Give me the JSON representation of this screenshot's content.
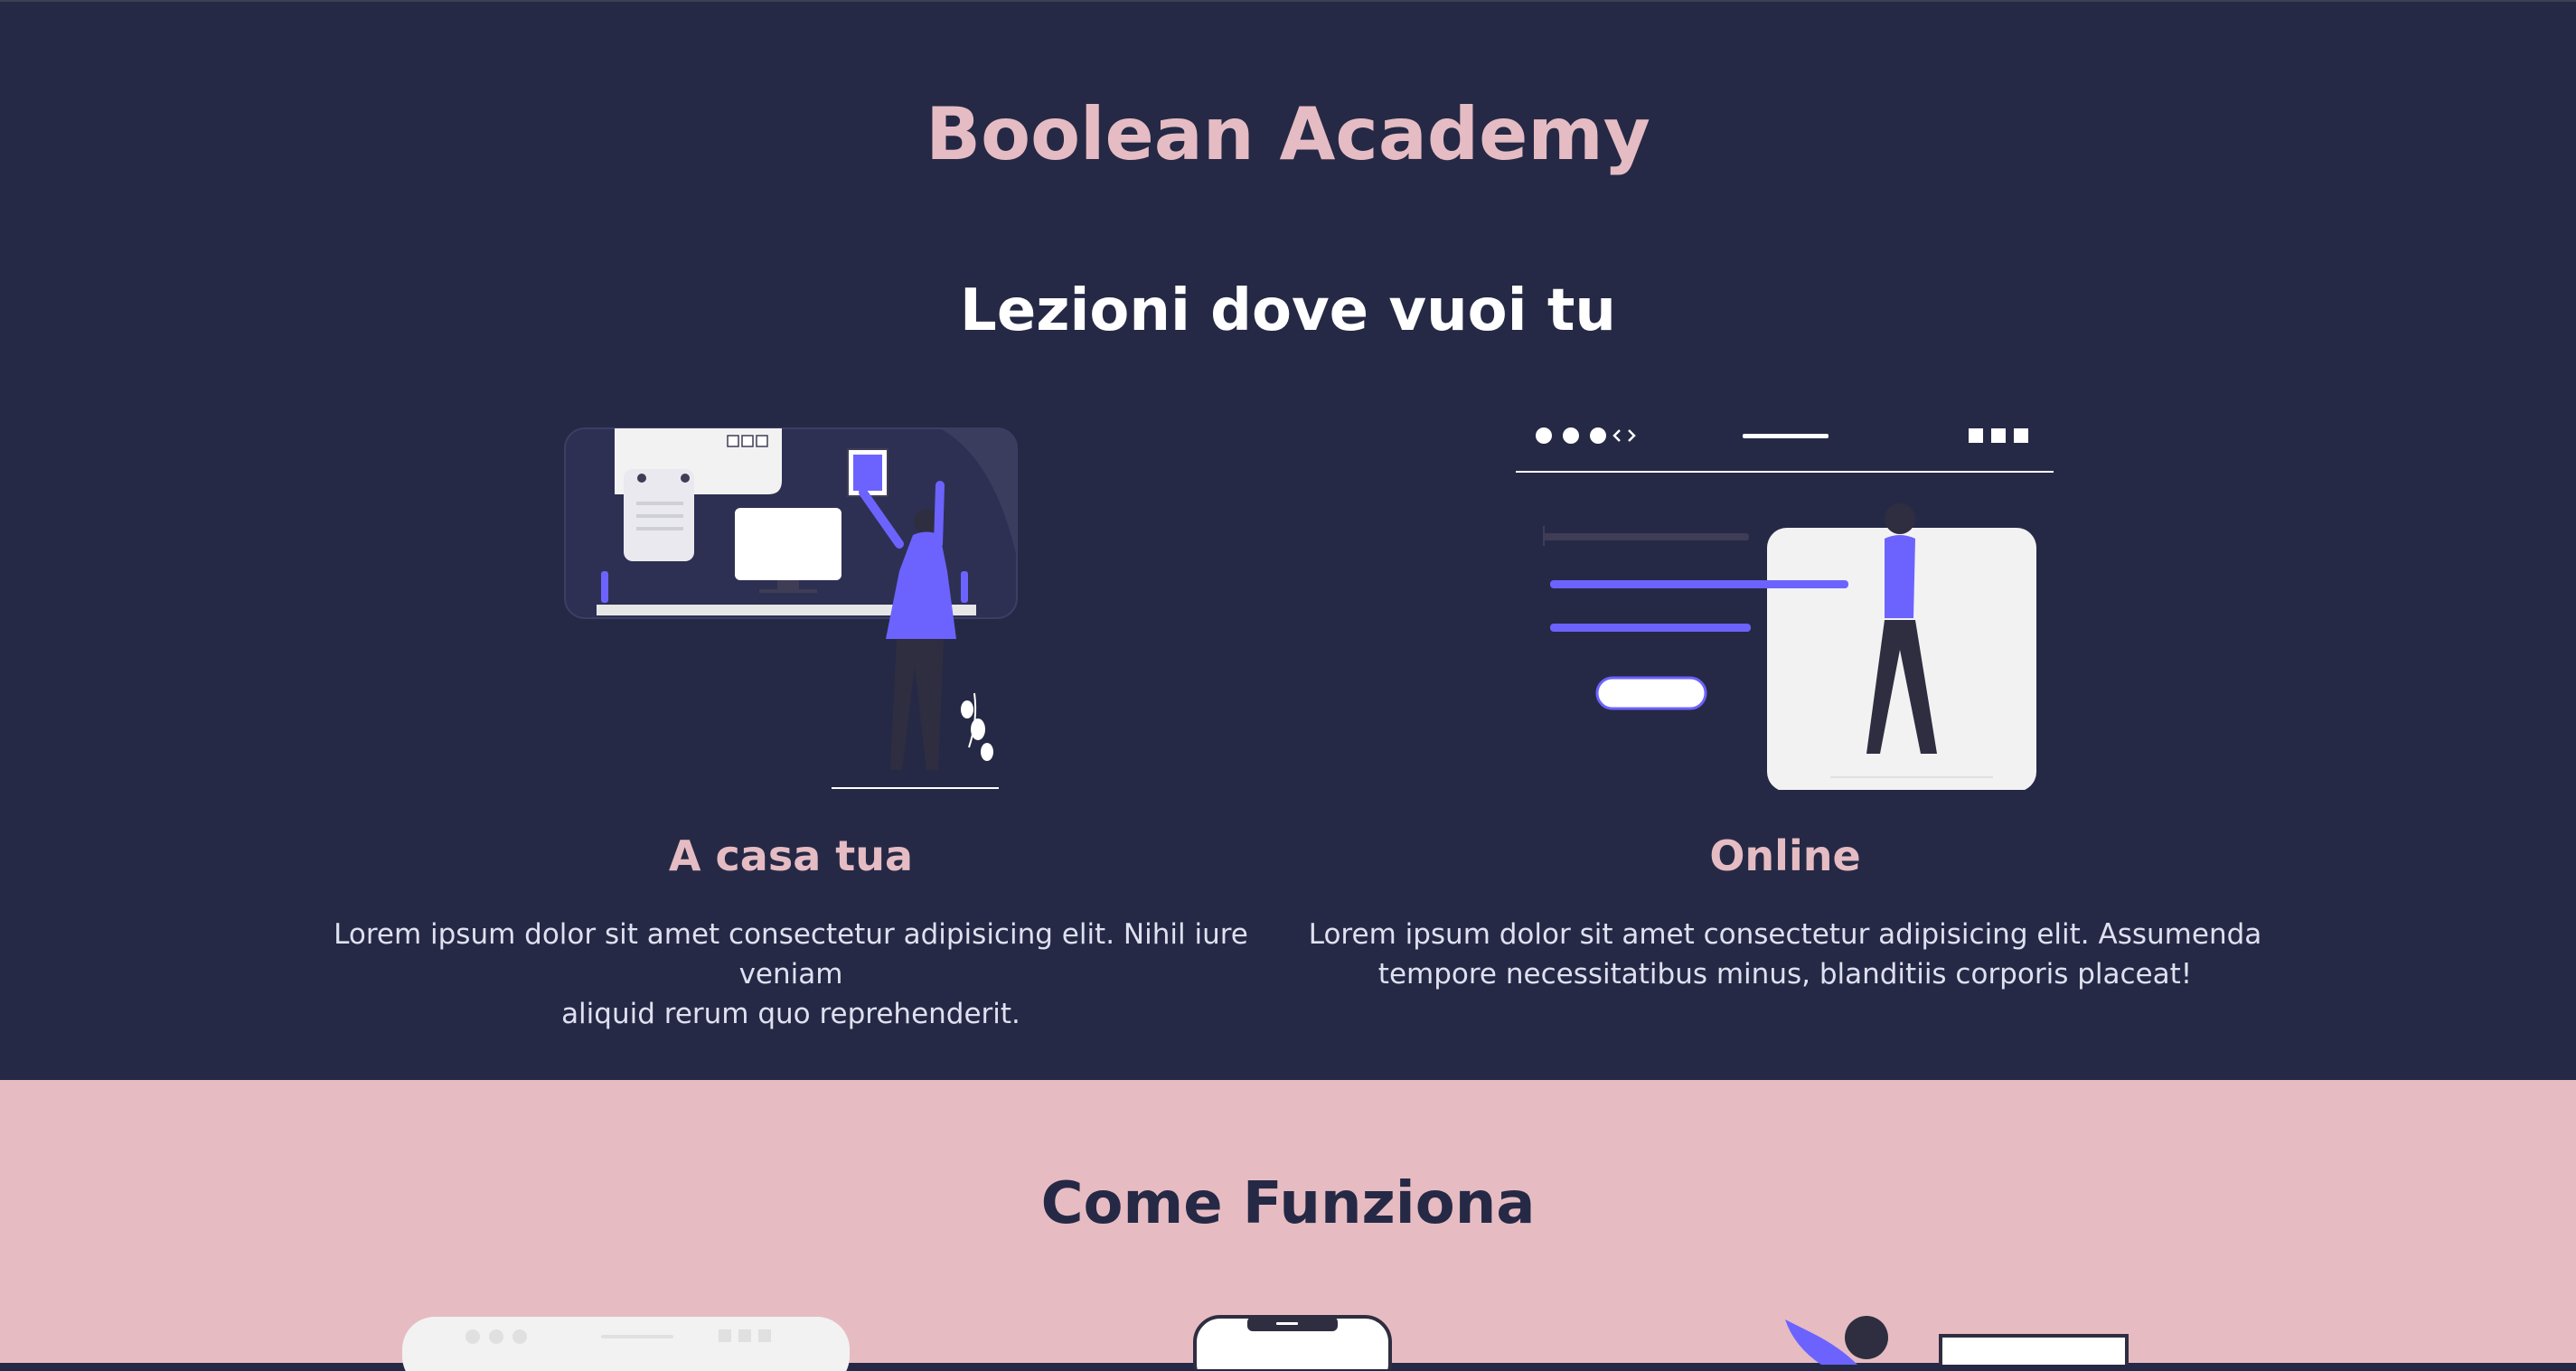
{
  "header": {
    "brand": "Boolean Academy"
  },
  "lessons": {
    "title": "Lezioni dove vuoi tu",
    "cards": [
      {
        "icon": "home-study-illustration",
        "title": "A casa tua",
        "text_line1": "Lorem ipsum dolor sit amet consectetur adipisicing elit. Nihil iure veniam",
        "text_line2": "aliquid rerum quo reprehenderit."
      },
      {
        "icon": "online-study-illustration",
        "title": "Online",
        "text_line1": "Lorem ipsum dolor sit amet consectetur adipisicing elit. Assumenda",
        "text_line2": "tempore necessitatibus minus, blanditiis corporis placeat!"
      }
    ]
  },
  "how_it_works": {
    "title": "Come Funziona"
  },
  "colors": {
    "dark_bg": "#252945",
    "pink_bg": "#e6bcc2",
    "accent_pink": "#e5bcc3",
    "accent_purple": "#6c63ff"
  }
}
